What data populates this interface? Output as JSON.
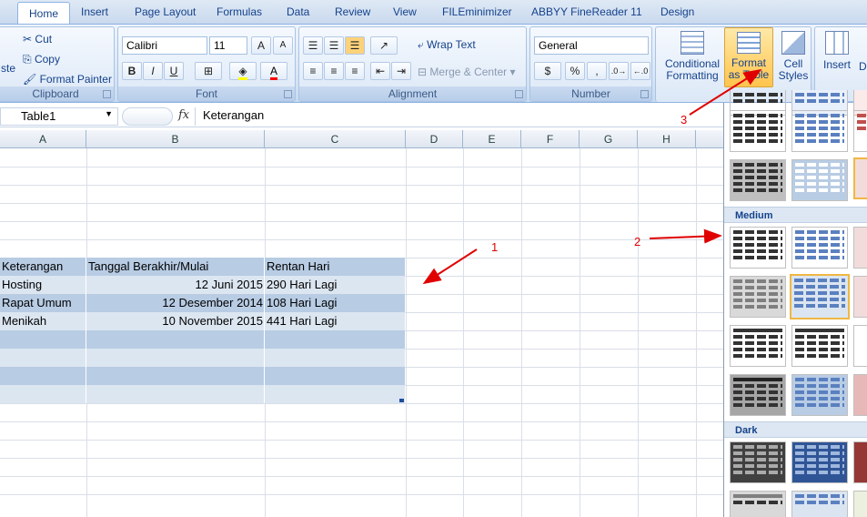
{
  "tabs": [
    {
      "label": "Home"
    },
    {
      "label": "Insert"
    },
    {
      "label": "Page Layout"
    },
    {
      "label": "Formulas"
    },
    {
      "label": "Data"
    },
    {
      "label": "Review"
    },
    {
      "label": "View"
    },
    {
      "label": "FILEminimizer"
    },
    {
      "label": "ABBYY FineReader 11"
    },
    {
      "label": "Design"
    }
  ],
  "clipboard": {
    "paste_label": "ste",
    "cut_label": "Cut",
    "copy_label": "Copy",
    "format_painter_label": "Format Painter",
    "group_label": "Clipboard"
  },
  "font": {
    "name": "Calibri",
    "size": "11",
    "bold": "B",
    "italic": "I",
    "underline": "U",
    "grow": "A",
    "shrink": "A",
    "font_color": "A",
    "group_label": "Font"
  },
  "alignment": {
    "wrap_text_label": "Wrap Text",
    "merge_center_label": "Merge & Center",
    "group_label": "Alignment"
  },
  "number": {
    "format": "General",
    "percent": "%",
    "comma": ",",
    "group_label": "Number"
  },
  "styles": {
    "conditional_formatting_label": "Conditional Formatting",
    "format_as_table_label": "Format as Table",
    "cell_styles_label": "Cell Styles"
  },
  "cells": {
    "insert_label": "Insert",
    "delete_label": "D"
  },
  "formula_bar": {
    "name_box": "Table1",
    "fx": "fx",
    "content": "Keterangan"
  },
  "columns": [
    "A",
    "B",
    "C",
    "D",
    "E",
    "F",
    "G",
    "H"
  ],
  "table": {
    "headers": [
      "Keterangan",
      "Tanggal Berakhir/Mulai",
      "Rentan Hari"
    ],
    "rows": [
      [
        "Hosting",
        "12 Juni 2015",
        "290 Hari Lagi"
      ],
      [
        "Rapat Umum",
        "12 Desember 2014",
        "108 Hari Lagi"
      ],
      [
        "Menikah",
        "10 November 2015",
        "441 Hari Lagi"
      ]
    ]
  },
  "annotations": [
    "1",
    "2",
    "3"
  ],
  "gallery": {
    "medium_label": "Medium",
    "dark_label": "Dark"
  },
  "colors": {
    "accent": "#15428b",
    "table_dark": "#b8cce4",
    "table_light": "#dce6f1",
    "annotation": "#e00000",
    "selected_style": "#f0b743"
  }
}
